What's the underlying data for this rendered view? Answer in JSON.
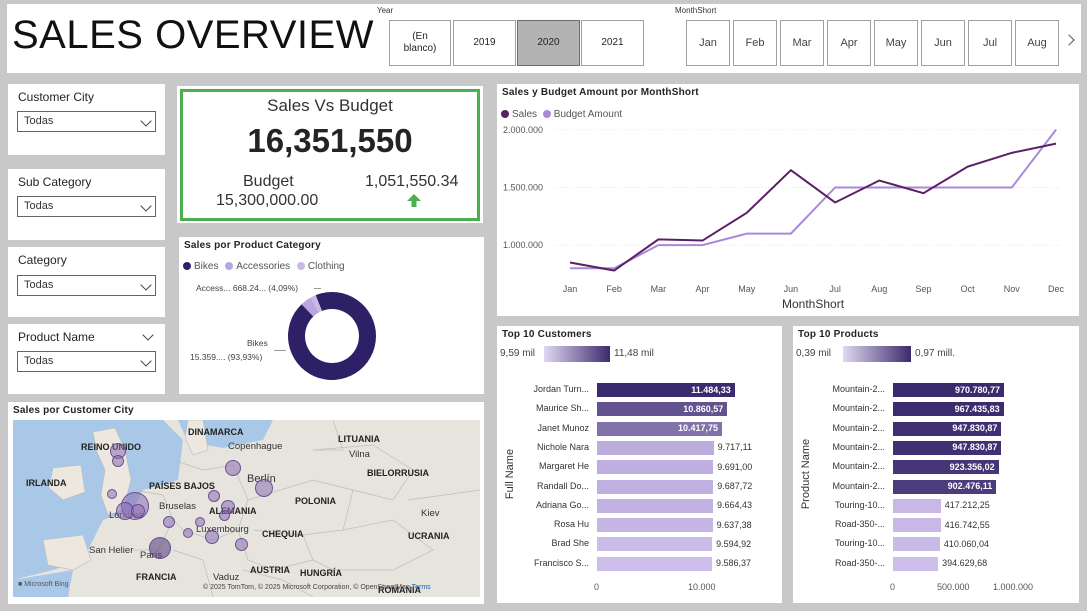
{
  "header": {
    "title": "SALES OVERVIEW",
    "year_label": "Year",
    "years": [
      "(En blanco)",
      "2019",
      "2020",
      "2021"
    ],
    "selected_year": "2020",
    "month_label": "MonthShort",
    "months": [
      "Jan",
      "Feb",
      "Mar",
      "Apr",
      "May",
      "Jun",
      "Jul",
      "Aug"
    ],
    "next_icon": "chevron-right-icon"
  },
  "filters": {
    "customer_city": {
      "label": "Customer City",
      "value": "Todas"
    },
    "sub_category": {
      "label": "Sub Category",
      "value": "Todas"
    },
    "category": {
      "label": "Category",
      "value": "Todas"
    },
    "product_name": {
      "label": "Product Name",
      "value": "Todas"
    }
  },
  "kpi": {
    "title": "Sales Vs Budget",
    "value": "16,351,550",
    "budget_label": "Budget",
    "budget_value": "15,300,000.00",
    "variance": "1,051,550.34",
    "variance_icon": "arrow-up-icon",
    "border_color": "#4caf50",
    "arrow_color": "#4caf50"
  },
  "donut": {
    "title": "Sales por Product Category",
    "legend": [
      {
        "name": "Bikes",
        "color": "#2e2066"
      },
      {
        "name": "Accessories",
        "color": "#b8a6de"
      },
      {
        "name": "Clothing",
        "color": "#c9b8e8"
      }
    ],
    "label_access": "Access... 668.24... (4,09%)",
    "label_bikes_1": "Bikes",
    "label_bikes_2": "15.359.... (93,93%)"
  },
  "line": {
    "title": "Sales y Budget Amount por MonthShort",
    "legend_sales": "Sales",
    "legend_budget": "Budget Amount",
    "x_title": "MonthShort",
    "y_ticks": [
      "2.000.000",
      "1.500.000",
      "1.000.000"
    ],
    "colors": {
      "sales": "#5b1f66",
      "budget": "#a98ad9"
    }
  },
  "customers": {
    "title": "Top 10 Customers",
    "scale_min": "9,59 mil",
    "scale_max": "11,48 mil",
    "axis_title": "Full Name",
    "x_ticks": [
      "0",
      "10.000"
    ]
  },
  "products": {
    "title": "Top 10 Products",
    "scale_min": "0,39 mil",
    "scale_max": "0,97 mill.",
    "axis_title": "Product Name",
    "x_ticks": [
      "0",
      "500.000",
      "1.000.000"
    ]
  },
  "map": {
    "title": "Sales por Customer City",
    "countries": [
      "REINO UNIDO",
      "DINAMARCA",
      "LITUANIA",
      "IRLANDA",
      "PAÍSES BAJOS",
      "BIELORRUSIA",
      "POLONIA",
      "ALEMANIA",
      "CHEQUIA",
      "UCRANIA",
      "FRANCIA",
      "AUSTRIA",
      "HUNGRÍA",
      "ROMANIA"
    ],
    "cities": [
      "Copenhague",
      "Vilna",
      "Berlín",
      "Bruselas",
      "Luxembourg",
      "Kiev",
      "San Helier",
      "Londres",
      "París",
      "Vaduz"
    ],
    "attribution": "© 2025 TomTom, © 2025 Microsoft Corporation, © OpenStreetMap",
    "terms": "Terms",
    "bing": "Microsoft Bing"
  },
  "chart_data": [
    {
      "type": "line",
      "title": "Sales y Budget Amount por MonthShort",
      "xlabel": "MonthShort",
      "ylabel": "",
      "x": [
        "Jan",
        "Feb",
        "Mar",
        "Apr",
        "May",
        "Jun",
        "Jul",
        "Aug",
        "Sep",
        "Oct",
        "Nov",
        "Dec"
      ],
      "ylim": [
        750000,
        2050000
      ],
      "series": [
        {
          "name": "Sales",
          "values": [
            850000,
            780000,
            1050000,
            1040000,
            1280000,
            1650000,
            1370000,
            1560000,
            1450000,
            1680000,
            1800000,
            1880000
          ]
        },
        {
          "name": "Budget Amount",
          "values": [
            800000,
            800000,
            1000000,
            1000000,
            1100000,
            1100000,
            1500000,
            1500000,
            1500000,
            1500000,
            1500000,
            2000000
          ]
        }
      ]
    },
    {
      "type": "pie",
      "title": "Sales por Product Category",
      "categories": [
        "Bikes",
        "Accessories",
        "Clothing"
      ],
      "values": [
        93.93,
        4.09,
        1.98
      ]
    },
    {
      "type": "bar",
      "title": "Top 10 Customers",
      "ylabel": "Full Name",
      "categories": [
        "Jordan Turn...",
        "Maurice Sh...",
        "Janet Munoz",
        "Nichole Nara",
        "Margaret He",
        "Randall Do...",
        "Adriana Go...",
        "Rosa Hu",
        "Brad She",
        "Francisco S..."
      ],
      "values": [
        11484.33,
        10860.57,
        10417.75,
        9717.11,
        9691.0,
        9687.72,
        9664.43,
        9637.38,
        9594.92,
        9586.37
      ],
      "labels": [
        "11.484,33",
        "10.860,57",
        "10.417,75",
        "9.717,11",
        "9.691,00",
        "9.687,72",
        "9.664,43",
        "9.637,38",
        "9.594,92",
        "9.586,37"
      ],
      "xlim": [
        0,
        14000
      ]
    },
    {
      "type": "bar",
      "title": "Top 10 Products",
      "ylabel": "Product Name",
      "categories": [
        "Mountain-2...",
        "Mountain-2...",
        "Mountain-2...",
        "Mountain-2...",
        "Mountain-2...",
        "Mountain-2...",
        "Touring-10...",
        "Road-350-...",
        "Touring-10...",
        "Road-350-..."
      ],
      "values": [
        970780.77,
        967435.83,
        947830.87,
        947830.87,
        923356.02,
        902476.11,
        417212.25,
        416742.55,
        410060.04,
        394629.68
      ],
      "labels": [
        "970.780,77",
        "967.435,83",
        "947.830,87",
        "947.830,87",
        "923.356,02",
        "902.476,11",
        "417.212,25",
        "416.742,55",
        "410.060,04",
        "394.629,68"
      ],
      "xlim": [
        0,
        1250000
      ]
    }
  ]
}
